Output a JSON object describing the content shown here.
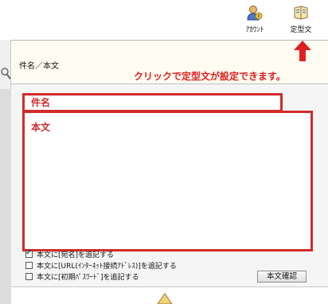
{
  "toolbar": {
    "account_label": "ｱｶｳﾝﾄ",
    "template_label": "定型文"
  },
  "header": {
    "field_label": "件名／本文"
  },
  "annotation": {
    "text": "クリックで定型文が設定できます。"
  },
  "form": {
    "subject_label": "件名",
    "body_label": "本文",
    "options": [
      {
        "label": "本文に[宛名]を追記する",
        "checked": true
      },
      {
        "label": "本文に[URL(ｲﾝﾀｰﾈｯﾄ接続ｱﾄﾞﾚｽ)]を追記する",
        "checked": false
      },
      {
        "label": "本文に[初期ﾊﾟｽﾜｰﾄﾞ]を追記する",
        "checked": false
      }
    ],
    "confirm_button": "本文確認"
  },
  "colors": {
    "annotation_red": "#e02020",
    "frame_red": "#d22a2a",
    "header_bg": "#fffdf2"
  },
  "icons": [
    "account-icon",
    "template-icon",
    "up-arrow-icon",
    "search-icon",
    "document-icon"
  ]
}
